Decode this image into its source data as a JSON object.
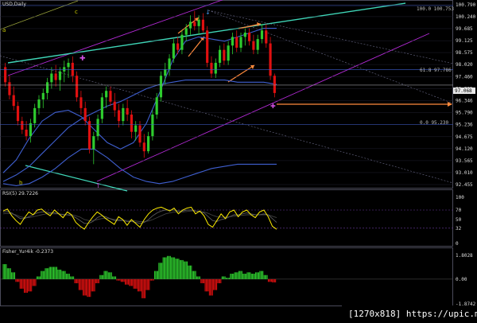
{
  "colors": {
    "background": "#000000",
    "bull": "#2ecc2e",
    "bear": "#e01010",
    "rsi": "#ffee00",
    "bands": "#3f5fd0",
    "channel": "#b32ad6",
    "trend": "#3fd6b8",
    "arrows": "#ff8a3d",
    "grid": "#7d7d96"
  },
  "panes": {
    "price_title": "USD,Daily",
    "rsi_title": "RSI(5) 29.7226",
    "fisher_title": "Fisher_Yur4ik -0.2373"
  },
  "wave_labels": {
    "a": "a",
    "b": "b",
    "c": "c"
  },
  "level_labels": {
    "fib_100": "100.0 100.753",
    "fib_618": "61.8 97.786",
    "fib_0": "0.0 95.230"
  },
  "price_axis_ticks": [
    "100.790",
    "100.240",
    "99.685",
    "99.125",
    "98.575",
    "98.020",
    "97.460",
    "96.905",
    "96.346",
    "95.790",
    "95.236",
    "94.675",
    "94.120",
    "93.565",
    "93.010",
    "92.455"
  ],
  "current_price": "97.068",
  "rsi_axis_ticks": [
    "100",
    "70",
    "50",
    "32",
    "0"
  ],
  "fisher_axis_ticks": [
    "1.8028",
    "0.00",
    "-1.8742"
  ],
  "footer_text": "[1270x818] https://upic.me/",
  "chart_data": [
    {
      "type": "candlestick",
      "title": "USD,Daily",
      "ylim": [
        92.455,
        100.79
      ],
      "grid": true,
      "ohlc": [
        [
          97.9,
          98.1,
          97.0,
          97.2
        ],
        [
          97.2,
          97.5,
          96.4,
          96.6
        ],
        [
          96.6,
          97.0,
          95.9,
          96.1
        ],
        [
          96.1,
          96.3,
          95.2,
          95.4
        ],
        [
          95.4,
          95.6,
          94.8,
          95.0
        ],
        [
          95.0,
          95.4,
          94.5,
          94.7
        ],
        [
          94.7,
          95.5,
          94.4,
          95.3
        ],
        [
          95.3,
          96.2,
          95.1,
          96.0
        ],
        [
          96.0,
          96.6,
          95.7,
          96.4
        ],
        [
          96.4,
          96.9,
          96.0,
          96.7
        ],
        [
          96.7,
          97.4,
          96.4,
          97.2
        ],
        [
          97.2,
          97.9,
          96.9,
          97.6
        ],
        [
          97.6,
          98.0,
          97.0,
          97.3
        ],
        [
          97.3,
          97.9,
          96.8,
          97.7
        ],
        [
          97.7,
          98.2,
          97.2,
          97.9
        ],
        [
          97.9,
          98.3,
          97.4,
          98.1
        ],
        [
          98.1,
          98.4,
          97.2,
          97.5
        ],
        [
          97.5,
          97.7,
          96.3,
          96.5
        ],
        [
          96.5,
          96.8,
          95.7,
          96.0
        ],
        [
          96.0,
          96.3,
          95.2,
          95.4
        ],
        [
          95.4,
          95.6,
          93.9,
          94.1
        ],
        [
          94.1,
          94.9,
          93.4,
          94.7
        ],
        [
          94.7,
          95.7,
          94.5,
          95.5
        ],
        [
          95.5,
          96.7,
          95.3,
          96.5
        ],
        [
          96.5,
          97.0,
          96.0,
          96.8
        ],
        [
          96.8,
          97.0,
          96.1,
          96.3
        ],
        [
          96.3,
          96.7,
          95.6,
          95.9
        ],
        [
          95.9,
          96.2,
          95.1,
          95.4
        ],
        [
          95.4,
          96.2,
          95.2,
          96.0
        ],
        [
          96.0,
          96.4,
          95.4,
          95.7
        ],
        [
          95.7,
          95.9,
          94.6,
          94.9
        ],
        [
          94.9,
          95.4,
          94.5,
          95.2
        ],
        [
          95.2,
          95.4,
          94.2,
          94.4
        ],
        [
          94.4,
          94.8,
          93.7,
          94.0
        ],
        [
          94.0,
          94.9,
          93.9,
          94.7
        ],
        [
          94.7,
          95.9,
          94.5,
          95.7
        ],
        [
          95.7,
          96.7,
          95.5,
          96.5
        ],
        [
          96.5,
          97.7,
          96.3,
          97.5
        ],
        [
          97.5,
          98.1,
          97.1,
          97.8
        ],
        [
          97.8,
          98.5,
          97.5,
          98.3
        ],
        [
          98.3,
          99.2,
          98.1,
          99.0
        ],
        [
          99.0,
          99.3,
          98.5,
          98.7
        ],
        [
          98.7,
          99.6,
          98.5,
          99.4
        ],
        [
          99.4,
          99.9,
          99.1,
          99.7
        ],
        [
          99.7,
          100.3,
          99.4,
          100.0
        ],
        [
          100.0,
          100.5,
          99.6,
          99.8
        ],
        [
          99.8,
          100.3,
          99.4,
          100.1
        ],
        [
          100.1,
          100.4,
          99.5,
          99.6
        ],
        [
          99.6,
          99.8,
          97.9,
          98.1
        ],
        [
          98.1,
          98.4,
          97.4,
          97.6
        ],
        [
          97.6,
          98.3,
          97.4,
          98.1
        ],
        [
          98.1,
          98.9,
          97.9,
          98.7
        ],
        [
          98.7,
          99.0,
          98.0,
          98.2
        ],
        [
          98.2,
          99.1,
          98.0,
          98.9
        ],
        [
          98.9,
          99.5,
          98.5,
          99.3
        ],
        [
          99.3,
          99.6,
          98.6,
          98.8
        ],
        [
          98.8,
          99.5,
          98.6,
          99.3
        ],
        [
          99.3,
          99.7,
          98.9,
          99.5
        ],
        [
          99.5,
          99.7,
          98.9,
          99.1
        ],
        [
          99.1,
          99.4,
          98.5,
          98.7
        ],
        [
          98.7,
          99.4,
          98.5,
          99.2
        ],
        [
          99.2,
          99.9,
          99.0,
          99.6
        ],
        [
          99.6,
          99.9,
          98.8,
          99.0
        ],
        [
          99.0,
          99.3,
          97.3,
          97.5
        ],
        [
          97.5,
          97.6,
          96.5,
          96.7
        ]
      ],
      "horizontal_levels": [
        100.753,
        97.786,
        95.23,
        97.068
      ],
      "overlay_series": [
        {
          "values": [
            93.0,
            93.6,
            94.6,
            95.4,
            95.8,
            95.9,
            95.6,
            95.0,
            94.4,
            94.1,
            94.4,
            95.3,
            96.7,
            98.2,
            99.1,
            99.3,
            99.2,
            99.1,
            99.3,
            99.5,
            99.7,
            99.7
          ]
        },
        {
          "values": [
            92.6,
            92.9,
            93.3,
            93.9,
            94.5,
            95.1,
            95.5,
            95.8,
            96.1,
            96.3,
            96.6,
            96.9,
            97.1,
            97.2,
            97.3,
            97.3,
            97.3,
            97.3,
            97.2,
            97.2,
            97.2,
            97.1
          ]
        },
        {
          "values": [
            92.5,
            92.4,
            92.5,
            92.8,
            93.2,
            93.7,
            94.1,
            94.1,
            93.7,
            93.2,
            92.8,
            92.6,
            92.5,
            92.6,
            92.8,
            93.0,
            93.2,
            93.3,
            93.4,
            93.4,
            93.4,
            93.4
          ]
        }
      ]
    },
    {
      "type": "line",
      "title": "RSI(5) 29.7226",
      "ylim": [
        0,
        100
      ],
      "levels": [
        70,
        32
      ],
      "series": [
        {
          "values": [
            68,
            72,
            58,
            48,
            40,
            54,
            66,
            60,
            70,
            72,
            64,
            58,
            70,
            62,
            54,
            66,
            60,
            44,
            36,
            30,
            44,
            56,
            66,
            60,
            52,
            46,
            40,
            56,
            50,
            38,
            50,
            42,
            34,
            50,
            62,
            70,
            74,
            76,
            72,
            68,
            74,
            62,
            70,
            74,
            76,
            62,
            68,
            58,
            40,
            34,
            48,
            62,
            52,
            66,
            70,
            56,
            66,
            70,
            60,
            54,
            66,
            70,
            56,
            36,
            29.7
          ]
        },
        {
          "values": [
            66,
            67,
            64,
            58,
            52,
            52,
            56,
            60,
            64,
            66,
            66,
            64,
            64,
            62,
            60,
            60,
            58,
            54,
            48,
            42,
            42,
            46,
            54,
            58,
            56,
            52,
            48,
            48,
            48,
            46,
            46,
            44,
            42,
            44,
            50,
            58,
            64,
            68,
            70,
            70,
            70,
            68,
            68,
            70,
            70,
            68,
            66,
            64,
            56,
            48,
            46,
            50,
            52,
            56,
            60,
            60,
            62,
            64,
            62,
            60,
            60,
            62,
            60,
            52,
            44
          ]
        },
        {
          "values": [
            62,
            63,
            62,
            60,
            56,
            54,
            54,
            56,
            58,
            60,
            62,
            62,
            62,
            62,
            61,
            60,
            60,
            58,
            55,
            50,
            48,
            48,
            50,
            52,
            53,
            52,
            50,
            50,
            49,
            48,
            48,
            47,
            46,
            46,
            47,
            50,
            54,
            58,
            62,
            64,
            66,
            66,
            66,
            67,
            68,
            68,
            67,
            66,
            63,
            59,
            56,
            55,
            55,
            56,
            57,
            58,
            59,
            60,
            60,
            60,
            60,
            60,
            60,
            57,
            54
          ]
        }
      ]
    },
    {
      "type": "bar",
      "title": "Fisher_Yur4ik -0.2373",
      "ylim": [
        -1.8742,
        1.8028
      ],
      "values": [
        1.1,
        0.8,
        0.5,
        -0.2,
        -0.7,
        -1.0,
        -0.9,
        -0.5,
        0.2,
        0.6,
        0.8,
        0.9,
        0.9,
        0.7,
        0.6,
        0.4,
        0.2,
        -0.3,
        -0.8,
        -1.2,
        -1.3,
        -0.9,
        -0.3,
        0.3,
        0.6,
        0.5,
        0.2,
        -0.1,
        -0.2,
        -0.4,
        -0.5,
        -0.7,
        -0.9,
        -1.4,
        -0.8,
        -0.1,
        0.6,
        1.2,
        1.6,
        1.7,
        1.6,
        1.5,
        1.4,
        1.3,
        1.0,
        0.6,
        0.2,
        -0.3,
        -0.9,
        -1.2,
        -0.8,
        -0.3,
        0.2,
        0.1,
        0.4,
        0.5,
        0.6,
        0.4,
        0.5,
        0.4,
        0.5,
        0.6,
        0.3,
        -0.2,
        -0.237
      ]
    }
  ]
}
